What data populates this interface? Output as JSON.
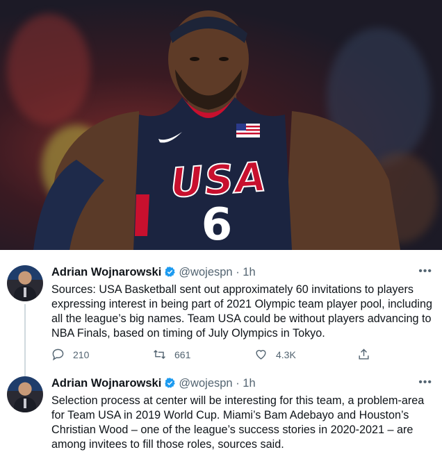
{
  "colors": {
    "accent": "#1d9bf0",
    "text_primary": "#0f1419",
    "text_secondary": "#536471",
    "jersey_navy": "#1b2440",
    "jersey_red": "#c8102e"
  },
  "hero_image": {
    "jersey_text": "USA",
    "jersey_number": "6"
  },
  "tweets": [
    {
      "author_name": "Adrian Wojnarowski",
      "handle": "@wojespn",
      "separator": "·",
      "time": "1h",
      "more_icon": "more-horizontal-icon",
      "text": "Sources: USA Basketball sent out approximately 60 invitations to players expressing interest in being part of 2021 Olympic team player pool, including all the league’s big names. Team USA could be without players advancing to NBA Finals, based on timing of July Olympics in Tokyo.",
      "actions": {
        "replies": "210",
        "retweets": "661",
        "likes": "4.3K"
      }
    },
    {
      "author_name": "Adrian Wojnarowski",
      "handle": "@wojespn",
      "separator": "·",
      "time": "1h",
      "more_icon": "more-horizontal-icon",
      "text": "Selection process at center will be interesting for this team, a problem-area for Team USA in 2019 World Cup. Miami’s Bam Adebayo and Houston’s Christian Wood – one of the league’s success stories in 2020-2021 – are among invitees to fill those roles, sources said."
    }
  ]
}
